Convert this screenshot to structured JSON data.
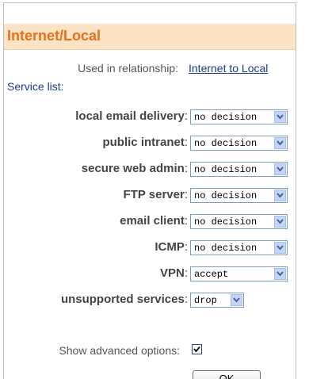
{
  "panel": {
    "title": "Internet/Local",
    "relationship_label": "Used in relationship:",
    "relationship_link": "Internet to Local",
    "service_list_heading": "Service list:"
  },
  "services": [
    {
      "label": "local email delivery",
      "value": "no decision"
    },
    {
      "label": "public intranet",
      "value": "no decision"
    },
    {
      "label": "secure web admin",
      "value": "no decision"
    },
    {
      "label": "FTP server",
      "value": "no decision"
    },
    {
      "label": "email client",
      "value": "no decision"
    },
    {
      "label": "ICMP",
      "value": "no decision"
    },
    {
      "label": "VPN",
      "value": "accept"
    },
    {
      "label": "unsupported services",
      "value": "drop"
    }
  ],
  "advanced": {
    "label": "Show advanced options:",
    "checked": true
  },
  "buttons": {
    "ok": "OK"
  },
  "icons": {
    "select_arrow": "chevron-down-icon",
    "checkbox": "checkmark-icon"
  },
  "colors": {
    "title": "#e8701c",
    "header_bg": "#fbe3c4",
    "link": "#1a3d8f"
  }
}
